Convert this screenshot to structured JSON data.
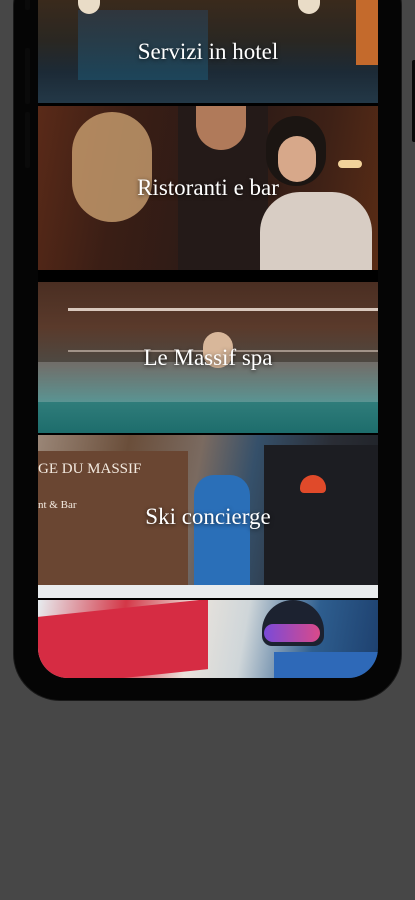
{
  "app": {
    "cards": [
      {
        "label": "Servizi in hotel"
      },
      {
        "label": "Ristoranti e bar"
      },
      {
        "label": "Le Massif spa"
      },
      {
        "label": "Ski concierge"
      },
      {
        "label": ""
      }
    ],
    "sign_text": "GE DU MASSIF",
    "sign_subtext": "nt & Bar"
  },
  "colors": {
    "background": "#474747",
    "phone_frame": "#050505",
    "card_label": "#ffffff"
  }
}
